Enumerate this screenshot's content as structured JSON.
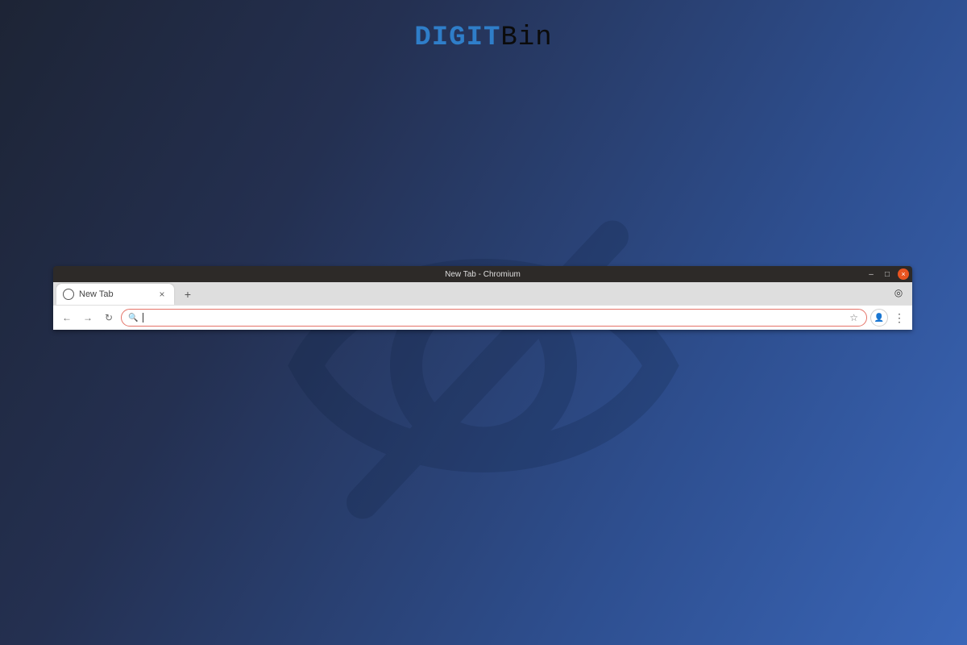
{
  "logo": {
    "part_a": "DIGIT",
    "part_b": "Bin"
  },
  "window": {
    "title": "New Tab - Chromium",
    "controls": {
      "minimize": "–",
      "maximize": "□",
      "close": "×"
    }
  },
  "tab": {
    "title": "New Tab",
    "close": "×"
  },
  "newtab": "+",
  "toolbar": {
    "back": "←",
    "forward": "→",
    "reload": "↻"
  },
  "omnibox": {
    "search_glyph": "🔍",
    "value": "",
    "placeholder": "",
    "star": "☆"
  },
  "profile_glyph": "👤",
  "menu_glyph": "⋮",
  "ext_glyph": "◎"
}
